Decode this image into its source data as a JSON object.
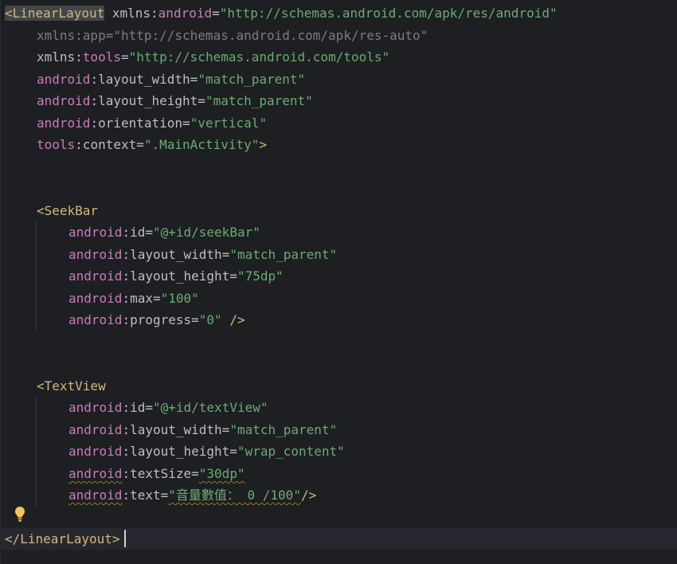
{
  "editor": {
    "lines": {
      "l1": {
        "open": "<",
        "tag": "LinearLayout",
        "space": " ",
        "attr": "xmlns:",
        "ns": "android",
        "eq": "=",
        "val": "\"http://schemas.android.com/apk/res/android\""
      },
      "l2": {
        "text": "xmlns:app=\"http://schemas.android.com/apk/res-auto\""
      },
      "l3": {
        "attr": "xmlns:",
        "ns": "tools",
        "eq": "=",
        "val": "\"http://schemas.android.com/tools\""
      },
      "l4": {
        "ns": "android",
        "attr": ":layout_width",
        "eq": "=",
        "val": "\"match_parent\""
      },
      "l5": {
        "ns": "android",
        "attr": ":layout_height",
        "eq": "=",
        "val": "\"match_parent\""
      },
      "l6": {
        "ns": "android",
        "attr": ":orientation",
        "eq": "=",
        "val": "\"vertical\""
      },
      "l7": {
        "ns": "tools",
        "attr": ":context",
        "eq": "=",
        "val": "\".MainActivity\"",
        "close": ">"
      },
      "l8": {
        "tag": "<SeekBar"
      },
      "l9": {
        "ns": "android",
        "attr": ":id",
        "eq": "=",
        "val": "\"@+id/seekBar\""
      },
      "l10": {
        "ns": "android",
        "attr": ":layout_width",
        "eq": "=",
        "val": "\"match_parent\""
      },
      "l11": {
        "ns": "android",
        "attr": ":layout_height",
        "eq": "=",
        "val": "\"75dp\""
      },
      "l12": {
        "ns": "android",
        "attr": ":max",
        "eq": "=",
        "val": "\"100\""
      },
      "l13": {
        "ns": "android",
        "attr": ":progress",
        "eq": "=",
        "val": "\"0\"",
        "close": " />"
      },
      "l14": {
        "tag": "<TextView"
      },
      "l15": {
        "ns": "android",
        "attr": ":id",
        "eq": "=",
        "val": "\"@+id/textView\""
      },
      "l16": {
        "ns": "android",
        "attr": ":layout_width",
        "eq": "=",
        "val": "\"match_parent\""
      },
      "l17": {
        "ns": "android",
        "attr": ":layout_height",
        "eq": "=",
        "val": "\"wrap_content\""
      },
      "l18": {
        "ns": "android",
        "attr": ":textSize",
        "eq": "=",
        "val": "\"30dp\""
      },
      "l19": {
        "ns": "android",
        "attr": ":text",
        "eq": "=",
        "val": "\"音量數值： 0 /100\"",
        "close": "/>"
      },
      "l20": {
        "tag": "</LinearLayout>"
      }
    },
    "colors": {
      "background": "#1e1f22",
      "current_line": "#26282e",
      "tag": "#d5b778",
      "namespace": "#c77dbb",
      "value": "#6aab73",
      "text": "#bcbec4",
      "dimmed": "#7a7e85"
    },
    "icons": {
      "intention": "lightbulb-icon"
    }
  }
}
